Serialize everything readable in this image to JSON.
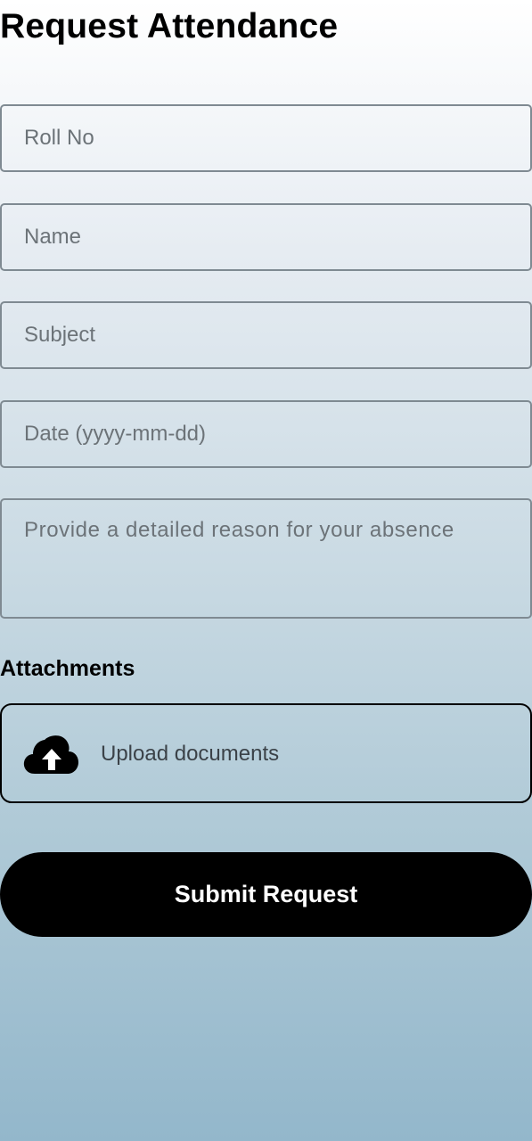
{
  "header": {
    "title": "Request Attendance"
  },
  "form": {
    "roll_no": {
      "placeholder": "Roll No",
      "value": ""
    },
    "name": {
      "placeholder": "Name",
      "value": ""
    },
    "subject": {
      "placeholder": "Subject",
      "value": ""
    },
    "date": {
      "placeholder": "Date (yyyy-mm-dd)",
      "value": ""
    },
    "reason": {
      "placeholder": "Provide a detailed reason for your absence",
      "value": ""
    }
  },
  "attachments": {
    "label": "Attachments",
    "upload_label": "Upload documents",
    "icon": "cloud-upload-icon"
  },
  "actions": {
    "submit_label": "Submit Request"
  },
  "colors": {
    "button_background": "#000000",
    "button_text": "#ffffff",
    "field_border": "#7f8a92",
    "gradient_top": "#ffffff",
    "gradient_bottom": "#93b7cb"
  }
}
